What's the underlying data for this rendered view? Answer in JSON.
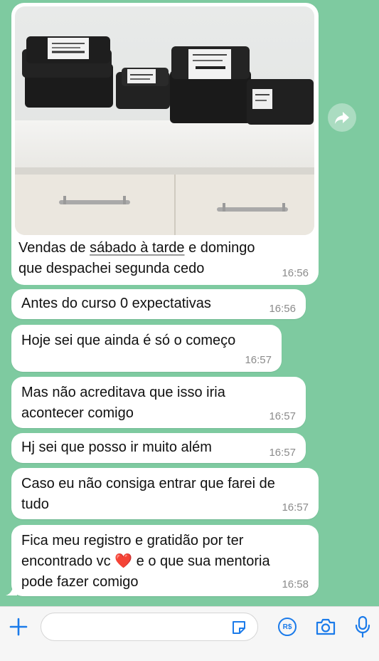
{
  "messages": [
    {
      "id": "m1",
      "text_parts": [
        "Vendas de ",
        "sábado à tarde",
        " e domingo\nque despachei segunda cedo"
      ],
      "time": "16:56",
      "has_photo": true
    },
    {
      "id": "m2",
      "text": "Antes do curso 0 expectativas",
      "time": "16:56"
    },
    {
      "id": "m3",
      "text": "Hoje sei que ainda é só o começo",
      "time": "16:57"
    },
    {
      "id": "m4",
      "text": "Mas não acreditava que isso iria\nacontecer comigo",
      "time": "16:57"
    },
    {
      "id": "m5",
      "text": "Hj sei que posso ir muito além",
      "time": "16:57"
    },
    {
      "id": "m6",
      "text": "Caso eu não consiga entrar que farei de\ntudo",
      "time": "16:57"
    },
    {
      "id": "m7",
      "text_before": "Fica meu registro e gratidão por ter\nencontrado vc ",
      "emoji": "❤️",
      "text_after": " e o que sua mentoria\npode fazer comigo",
      "time": "16:58"
    }
  ],
  "composer": {
    "input_value": "",
    "icons": [
      "plus-icon",
      "sticker-icon",
      "payment-icon",
      "camera-icon",
      "microphone-icon"
    ],
    "payment_label": "R$"
  },
  "colors": {
    "chat_background": "#7ecaa0",
    "bubble": "#ffffff",
    "time": "#8b8b8b",
    "accent": "#1b7bea",
    "heart": "#e0202b"
  }
}
